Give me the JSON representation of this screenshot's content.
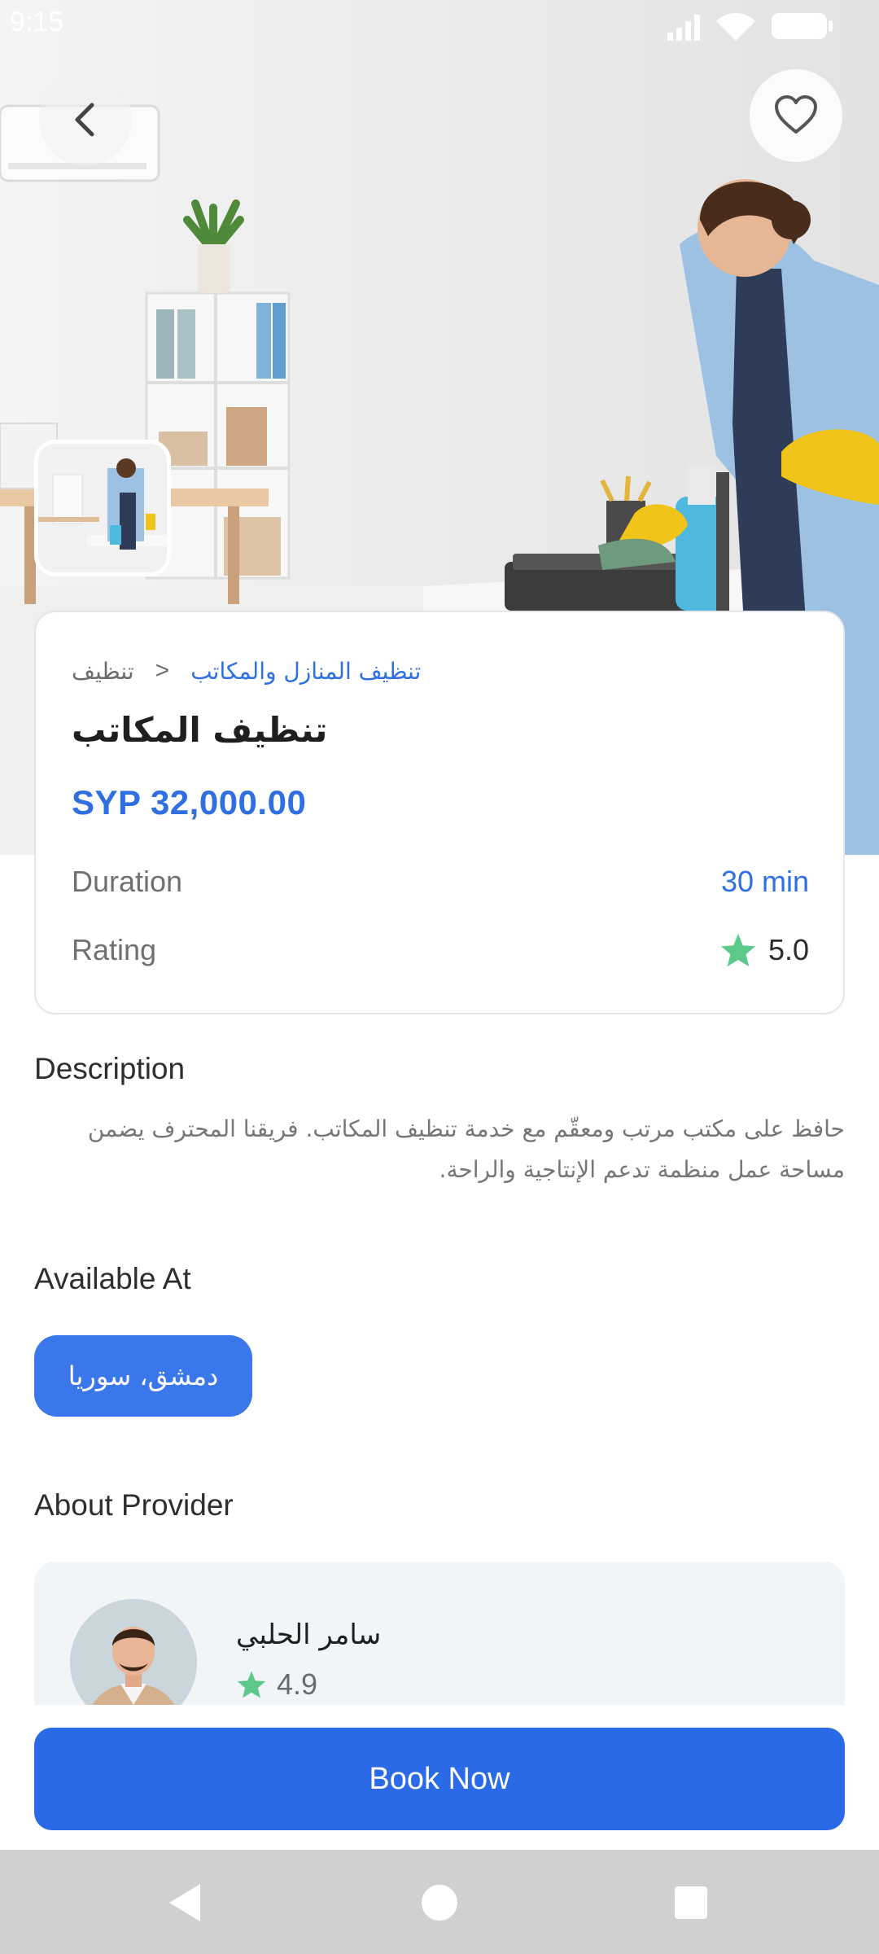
{
  "status_bar": {
    "time": "9:15"
  },
  "hero": {
    "back_icon": "chevron-left-icon",
    "favorite_icon": "heart-outline-icon"
  },
  "service": {
    "breadcrumb_root": "تنظيف",
    "breadcrumb_separator": ">",
    "breadcrumb_current": "تنظيف المنازل والمكاتب",
    "title": "تنظيف المكاتب",
    "price": "SYP 32,000.00",
    "duration_label": "Duration",
    "duration_value": "30 min",
    "rating_label": "Rating",
    "rating_value": "5.0"
  },
  "description": {
    "title": "Description",
    "text": "حافظ على مكتب مرتب ومعقّم مع خدمة تنظيف المكاتب. فريقنا المحترف يضمن مساحة عمل منظمة تدعم الإنتاجية والراحة."
  },
  "availability": {
    "title": "Available At",
    "location": "دمشق، سوريا"
  },
  "provider": {
    "title": "About Provider",
    "name": "سامر الحلبي",
    "rating": "4.9"
  },
  "actions": {
    "book_label": "Book Now"
  },
  "colors": {
    "accent": "#2a6ae6",
    "star": "#5cc98a",
    "chip": "#3a77ea",
    "nav_bar": "#d0d0d0"
  }
}
